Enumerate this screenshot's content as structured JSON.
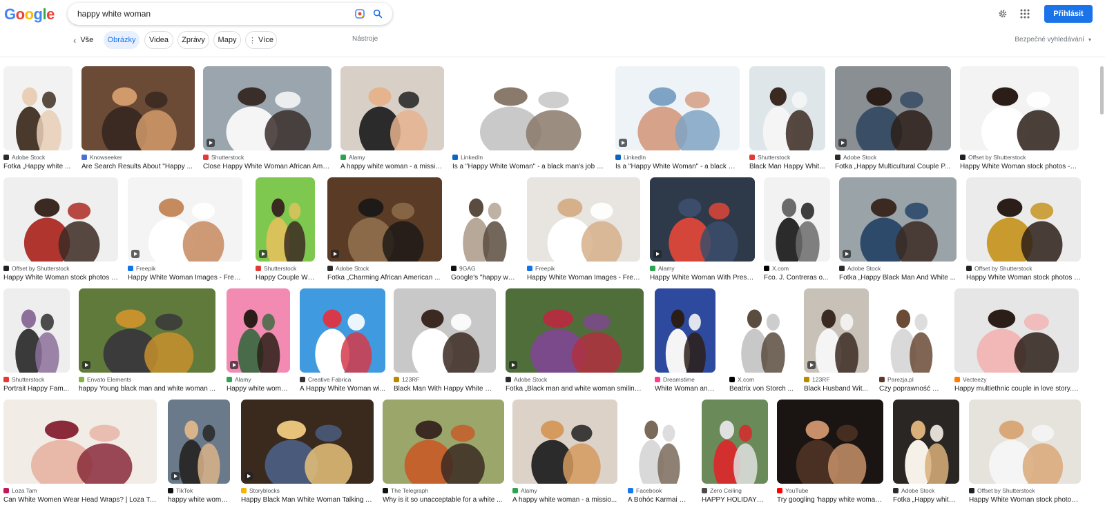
{
  "logo": {
    "letters": [
      "G",
      "o",
      "o",
      "g",
      "l",
      "e"
    ],
    "colors": [
      "#4285f4",
      "#ea4335",
      "#fbbc05",
      "#4285f4",
      "#34a853",
      "#ea4335"
    ]
  },
  "search": {
    "query": "happy white woman"
  },
  "header": {
    "signin_label": "Přihlásit"
  },
  "nav": {
    "back_label": "Vše",
    "chips": [
      "Obrázky",
      "Videa",
      "Zprávy",
      "Mapy",
      "Více"
    ],
    "tools_label": "Nástroje",
    "safesearch_label": "Bezpečné vyhledávání"
  },
  "results": [
    [
      {
        "source": "Adobe Stock",
        "caption": "Fotka „Happy white ...",
        "fav": "#2b2b2b",
        "palette": [
          "#f2f2f2",
          "#4a3a2e",
          "#e9cfb6"
        ]
      },
      {
        "source": "Knowseeker",
        "caption": "Are Search Results About \"Happy ...",
        "fav": "#4a6fd6",
        "palette": [
          "#6b4a36",
          "#3b2a22",
          "#d19a6a"
        ]
      },
      {
        "source": "Shutterstock",
        "caption": "Close Happy White Woman African Ame...",
        "fav": "#e53935",
        "palette": [
          "#9aa5ad",
          "#f5f5f5",
          "#3a2e2a"
        ]
      },
      {
        "source": "Alamy",
        "caption": "A happy white woman - a missio...",
        "fav": "#2ea44f",
        "palette": [
          "#d8cfc6",
          "#2b2b2b",
          "#e5b38e"
        ]
      },
      {
        "source": "LinkedIn",
        "caption": "Is a \"Happy White Woman\" - a black man's job acc...",
        "fav": "#0a66c2",
        "palette": [
          "#ffffff",
          "#c9c9c9",
          "#8a7a6b"
        ]
      },
      {
        "source": "LinkedIn",
        "caption": "Is a \"Happy White Woman\" - a black ma...",
        "fav": "#0a66c2",
        "palette": [
          "#eef3f8",
          "#d6a38a",
          "#7fa3c4"
        ]
      },
      {
        "source": "Shutterstock",
        "caption": "Black Man Happy Whit...",
        "fav": "#e53935",
        "palette": [
          "#dfe6ea",
          "#f5f5f5",
          "#3b2a22"
        ]
      },
      {
        "source": "Adobe Stock",
        "caption": "Fotka „Happy Multicultural Couple P...",
        "fav": "#2b2b2b",
        "palette": [
          "#8a8f93",
          "#3a4f66",
          "#2b1e18"
        ]
      },
      {
        "source": "Offset by Shutterstock",
        "caption": "Happy White Woman stock photos - O...",
        "fav": "#202124",
        "palette": [
          "#f3f3f3",
          "#ffffff",
          "#2b1e18"
        ]
      }
    ],
    [
      {
        "source": "Offset by Shutterstock",
        "caption": "Happy White Woman stock photos - ...",
        "fav": "#202124",
        "palette": [
          "#efefef",
          "#b0352f",
          "#3b2a22"
        ]
      },
      {
        "source": "Freepik",
        "caption": "Happy White Woman Images - Free ...",
        "fav": "#1273eb",
        "palette": [
          "#f4f4f4",
          "#ffffff",
          "#c58a5e"
        ]
      },
      {
        "source": "Shutterstock",
        "caption": "Happy Couple Whit...",
        "fav": "#e53935",
        "palette": [
          "#7ec850",
          "#d9c25a",
          "#3b2a22"
        ]
      },
      {
        "source": "Adobe Stock",
        "caption": "Fotka „Charming African American ...",
        "fav": "#2b2b2b",
        "palette": [
          "#5a3b26",
          "#8a6a48",
          "#1e1a18"
        ]
      },
      {
        "source": "9GAG",
        "caption": "Google's \"happy whi...",
        "fav": "#111111",
        "palette": [
          "#ffffff",
          "#b8a89a",
          "#5b4c40"
        ]
      },
      {
        "source": "Freepik",
        "caption": "Happy White Woman Images - Free ...",
        "fav": "#1273eb",
        "palette": [
          "#e8e4e0",
          "#ffffff",
          "#d6b08a"
        ]
      },
      {
        "source": "Alamy",
        "caption": "Happy White Woman With Prese...",
        "fav": "#2ea44f",
        "palette": [
          "#2e3a4a",
          "#d4463a",
          "#3b4d6b"
        ]
      },
      {
        "source": "X.com",
        "caption": "Fco. J. Contreras o...",
        "fav": "#000000",
        "palette": [
          "#f2f2f2",
          "#2b2b2b",
          "#6b6b6b"
        ]
      },
      {
        "source": "Adobe Stock",
        "caption": "Fotka „Happy Black Man And White ...",
        "fav": "#2b2b2b",
        "palette": [
          "#9aa3a8",
          "#2d4a6a",
          "#3b2a22"
        ]
      },
      {
        "source": "Offset by Shutterstock",
        "caption": "Happy White Woman stock photos -...",
        "fav": "#202124",
        "palette": [
          "#ebebeb",
          "#c99a2e",
          "#2b1e18"
        ]
      }
    ],
    [
      {
        "source": "Shutterstock",
        "caption": "Portrait Happy Fam...",
        "fav": "#e53935",
        "palette": [
          "#eeeeee",
          "#3a3a3a",
          "#8c6f9a"
        ]
      },
      {
        "source": "Envato Elements",
        "caption": "happy Young black man and white woman ...",
        "fav": "#82b541",
        "palette": [
          "#5f7a3a",
          "#3b3b3b",
          "#c7912e"
        ]
      },
      {
        "source": "Alamy",
        "caption": "Happy white woma...",
        "fav": "#2ea44f",
        "palette": [
          "#f28ab1",
          "#4a6b4a",
          "#2b1e18"
        ]
      },
      {
        "source": "Creative Fabrica",
        "caption": "A Happy White Woman wi...",
        "fav": "#333333",
        "palette": [
          "#3f9ae0",
          "#ffffff",
          "#d63a4a"
        ]
      },
      {
        "source": "123RF",
        "caption": "Black Man With Happy White W...",
        "fav": "#b88a00",
        "palette": [
          "#c8c8c8",
          "#ffffff",
          "#3b2a22"
        ]
      },
      {
        "source": "Adobe Stock",
        "caption": "Fotka „Black man and white woman smiling...",
        "fav": "#2b2b2b",
        "palette": [
          "#4f6e3a",
          "#7a4a8a",
          "#b03040"
        ]
      },
      {
        "source": "Dreamstime",
        "caption": "White Woman and ...",
        "fav": "#ff3c8e",
        "palette": [
          "#2e4a9e",
          "#f5f5f5",
          "#2b1e18"
        ]
      },
      {
        "source": "X.com",
        "caption": "Beatrix von Storch ...",
        "fav": "#000000",
        "palette": [
          "#ffffff",
          "#c8c8c8",
          "#5b4c40"
        ]
      },
      {
        "source": "123RF",
        "caption": "Black Husband Wit...",
        "fav": "#b88a00",
        "palette": [
          "#c7c1b8",
          "#f5f5f5",
          "#3b2a22"
        ]
      },
      {
        "source": "Parezja.pl",
        "caption": "Czy poprawność po...",
        "fav": "#5b3a2a",
        "palette": [
          "#ffffff",
          "#d9d9d9",
          "#6b4a36"
        ]
      },
      {
        "source": "Vecteezy",
        "caption": "Happy multiethnic couple in love story. ...",
        "fav": "#ff7c00",
        "palette": [
          "#e6e6e6",
          "#f2b7b7",
          "#2b1e18"
        ]
      }
    ],
    [
      {
        "source": "Loza Tam",
        "caption": "Can White Women Wear Head Wraps? | Loza Tam",
        "fav": "#c2185b",
        "palette": [
          "#f1ece6",
          "#e8b8a8",
          "#8a2a3a"
        ]
      },
      {
        "source": "TikTok",
        "caption": "happy white woman...",
        "fav": "#111111",
        "palette": [
          "#6a7a8a",
          "#2b2b2b",
          "#d9b48a"
        ]
      },
      {
        "source": "Storyblocks",
        "caption": "Happy Black Man White Woman Talking At...",
        "fav": "#f4b400",
        "palette": [
          "#3a2a1e",
          "#4a5a7a",
          "#e6c27a"
        ]
      },
      {
        "source": "The Telegraph",
        "caption": "Why is it so unacceptable for a white ...",
        "fav": "#111111",
        "palette": [
          "#9aa66a",
          "#c4622d",
          "#3b2a22"
        ]
      },
      {
        "source": "Alamy",
        "caption": "A happy white woman - a missio...",
        "fav": "#2ea44f",
        "palette": [
          "#dcd2c8",
          "#2b2b2b",
          "#d59a5e"
        ]
      },
      {
        "source": "Facebook",
        "caption": "A Bohóc Karmai Kö...",
        "fav": "#1877f2",
        "palette": [
          "#ffffff",
          "#d9d9d9",
          "#7a6a5a"
        ]
      },
      {
        "source": "Zero Ceiling",
        "caption": "HAPPY HOLIDAYS ...",
        "fav": "#4a4a4a",
        "palette": [
          "#6a8a5a",
          "#d32f2f",
          "#e0e0e0"
        ]
      },
      {
        "source": "YouTube",
        "caption": "Try googling 'happy white woman'...",
        "fav": "#ff0000",
        "palette": [
          "#1a1412",
          "#4a3022",
          "#c8906a"
        ]
      },
      {
        "source": "Adobe Stock",
        "caption": "Fotka „Happy white ...",
        "fav": "#2b2b2b",
        "palette": [
          "#2a2624",
          "#f5f0e8",
          "#d9b07a"
        ]
      },
      {
        "source": "Offset by Shutterstock",
        "caption": "Happy White Woman stock photos ...",
        "fav": "#202124",
        "palette": [
          "#e6e2dc",
          "#f5f5f5",
          "#d9a878"
        ]
      }
    ]
  ]
}
